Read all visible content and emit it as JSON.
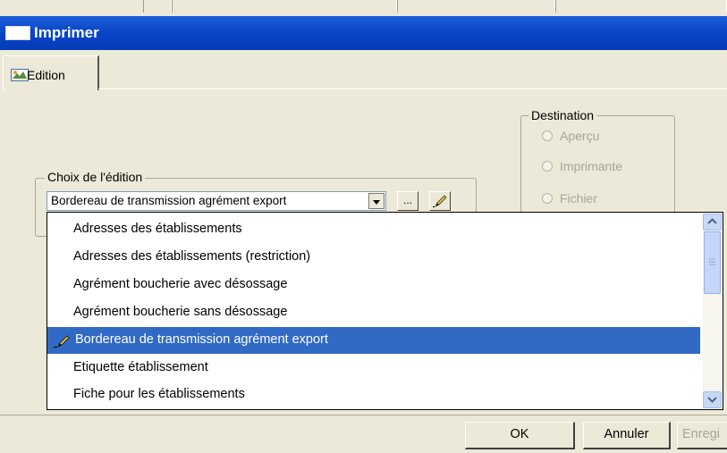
{
  "window": {
    "title": "Imprimer"
  },
  "tabs": [
    {
      "label": "Edition"
    }
  ],
  "destination": {
    "legend": "Destination",
    "options": [
      {
        "label": "Aperçu"
      },
      {
        "label": "Imprimante"
      },
      {
        "label": "Fichier"
      }
    ]
  },
  "choice": {
    "legend": "Choix de l'édition",
    "selected": "Bordereau de transmission agrément export",
    "browse_label": "..."
  },
  "dropdown": {
    "items": [
      "Adresses des établissements",
      "Adresses des établissements (restriction)",
      "Agrément boucherie avec désossage",
      "Agrément boucherie sans désossage",
      "Bordereau de transmission agrément export",
      "Etiquette établissement",
      "Fiche pour les établissements"
    ],
    "selected_index": 4
  },
  "buttons": {
    "ok": "OK",
    "cancel": "Annuler",
    "save": "Enregi"
  },
  "colors": {
    "titlebar": "#0a46c8",
    "selection": "#316ac5",
    "dialog_bg": "#ece9d8"
  }
}
